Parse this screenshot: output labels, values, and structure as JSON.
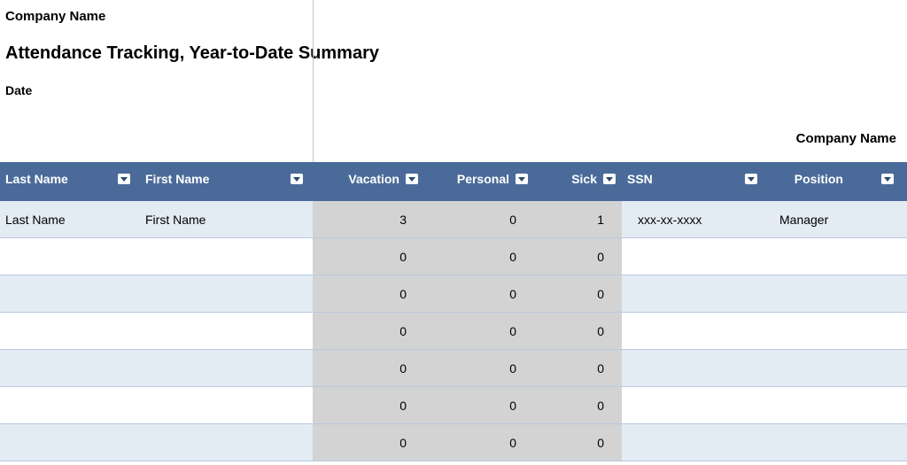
{
  "header": {
    "company_top": "Company Name",
    "title": "Attendance Tracking, Year-to-Date Summary",
    "date_label": "Date",
    "company_right": "Company Name"
  },
  "columns": {
    "last": "Last Name",
    "first": "First Name",
    "vacation": "Vacation",
    "personal": "Personal",
    "sick": "Sick",
    "ssn": "SSN",
    "position": "Position"
  },
  "rows": [
    {
      "last": "Last Name",
      "first": "First Name",
      "vacation": "3",
      "personal": "0",
      "sick": "1",
      "ssn": "xxx-xx-xxxx",
      "position": "Manager"
    },
    {
      "last": "",
      "first": "",
      "vacation": "0",
      "personal": "0",
      "sick": "0",
      "ssn": "",
      "position": ""
    },
    {
      "last": "",
      "first": "",
      "vacation": "0",
      "personal": "0",
      "sick": "0",
      "ssn": "",
      "position": ""
    },
    {
      "last": "",
      "first": "",
      "vacation": "0",
      "personal": "0",
      "sick": "0",
      "ssn": "",
      "position": ""
    },
    {
      "last": "",
      "first": "",
      "vacation": "0",
      "personal": "0",
      "sick": "0",
      "ssn": "",
      "position": ""
    },
    {
      "last": "",
      "first": "",
      "vacation": "0",
      "personal": "0",
      "sick": "0",
      "ssn": "",
      "position": ""
    },
    {
      "last": "",
      "first": "",
      "vacation": "0",
      "personal": "0",
      "sick": "0",
      "ssn": "",
      "position": ""
    }
  ]
}
